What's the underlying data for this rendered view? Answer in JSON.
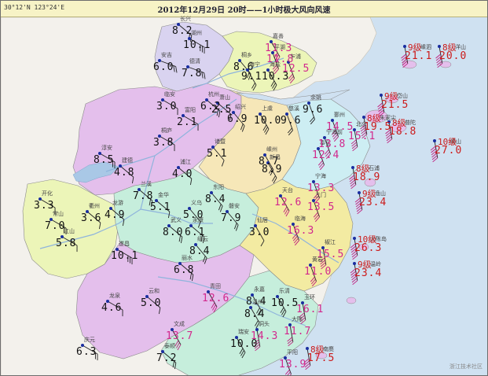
{
  "header": {
    "coords": "30°12'N 123°24'E",
    "title": "2012年12月29日 20时——1小时极大风向风速"
  },
  "watermark": "浙江技术社区",
  "colors": {
    "sea": "#cfe1f1",
    "land": "#f3f1ec",
    "river": "#a9c8e6",
    "station": "#1a2ea0",
    "normal_text": "#111111",
    "high_text": "#d2288d",
    "grade_text": "#cc1b1b"
  },
  "regions": [
    {
      "name": "huzhou",
      "fill": "#d9d3f0"
    },
    {
      "name": "jiaxing",
      "fill": "#ecf5b8"
    },
    {
      "name": "hangzhou",
      "fill": "#e4bfec"
    },
    {
      "name": "shaoxing",
      "fill": "#f6e7b8"
    },
    {
      "name": "ningbo",
      "fill": "#cdeef3"
    },
    {
      "name": "jinhua",
      "fill": "#c6eedc"
    },
    {
      "name": "quzhou",
      "fill": "#ecf5b8"
    },
    {
      "name": "taizhou",
      "fill": "#f3eba2"
    },
    {
      "name": "lishui",
      "fill": "#e4bfec"
    },
    {
      "name": "wenzhou",
      "fill": "#c6eedc"
    },
    {
      "name": "zhoushan",
      "fill": "#e4bfec"
    }
  ],
  "stations": [
    {
      "label": "长兴",
      "value": "8.2",
      "level": "normal"
    },
    {
      "label": "湖州",
      "value": "10.1",
      "level": "normal"
    },
    {
      "label": "嘉善",
      "value": "11.3",
      "level": "high"
    },
    {
      "label": "平湖",
      "value": "11.8",
      "level": "high"
    },
    {
      "label": "安吉",
      "value": "6.0",
      "level": "normal"
    },
    {
      "label": "德清",
      "value": "7.8",
      "level": "normal"
    },
    {
      "label": "桐乡",
      "value": "8.6",
      "level": "normal"
    },
    {
      "label": "海宁",
      "value": "9.1",
      "level": "normal"
    },
    {
      "label": "海盐",
      "value": "10.3",
      "level": "normal"
    },
    {
      "label": "乍浦",
      "value": "12.5",
      "level": "high"
    },
    {
      "label": "临安",
      "value": "3.0",
      "level": "normal"
    },
    {
      "label": "杭州",
      "value": "6.2",
      "level": "normal"
    },
    {
      "label": "萧山",
      "value": "2.5",
      "level": "normal"
    },
    {
      "label": "富阳",
      "value": "2.1",
      "level": "normal"
    },
    {
      "label": "绍兴",
      "value": "6.9",
      "level": "normal"
    },
    {
      "label": "上虞",
      "value": "10.0",
      "level": "normal"
    },
    {
      "label": "余姚",
      "value": "9.6",
      "level": "normal"
    },
    {
      "label": "慈溪",
      "value": "9.6",
      "level": "normal"
    },
    {
      "label": "桐庐",
      "value": "3.8",
      "level": "normal"
    },
    {
      "label": "诸暨",
      "value": "5.1",
      "level": "normal"
    },
    {
      "label": "淳安",
      "value": "8.5",
      "level": "normal"
    },
    {
      "label": "建德",
      "value": "4.8",
      "level": "normal"
    },
    {
      "label": "浦江",
      "value": "4.0",
      "level": "normal"
    },
    {
      "label": "嵊州",
      "value": "8.7",
      "level": "normal"
    },
    {
      "label": "新昌",
      "value": "8.9",
      "level": "normal"
    },
    {
      "label": "鄞州",
      "value": "14.5",
      "level": "high"
    },
    {
      "label": "北仑",
      "value": "15.1",
      "level": "high"
    },
    {
      "label": "奉化",
      "value": "12.4",
      "level": "high"
    },
    {
      "label": "宁海前",
      "value": "13.8",
      "level": "high"
    },
    {
      "label": "开化",
      "value": "3.3",
      "level": "normal"
    },
    {
      "label": "常山",
      "value": "7.0",
      "level": "normal"
    },
    {
      "label": "衢州",
      "value": "3.6",
      "level": "normal"
    },
    {
      "label": "龙游",
      "value": "4.9",
      "level": "normal"
    },
    {
      "label": "江山",
      "value": "5.8",
      "level": "normal"
    },
    {
      "label": "兰溪",
      "value": "7.8",
      "level": "normal"
    },
    {
      "label": "金华",
      "value": "5.1",
      "level": "normal"
    },
    {
      "label": "义乌",
      "value": "5.0",
      "level": "normal"
    },
    {
      "label": "东阳",
      "value": "8.4",
      "level": "normal"
    },
    {
      "label": "磐安",
      "value": "7.9",
      "level": "normal"
    },
    {
      "label": "天台",
      "value": "12.6",
      "level": "high"
    },
    {
      "label": "宁海",
      "value": "13.3",
      "level": "high"
    },
    {
      "label": "三门",
      "value": "13.5",
      "level": "high"
    },
    {
      "label": "武义",
      "value": "8.0",
      "level": "normal"
    },
    {
      "label": "永康",
      "value": "6.1",
      "level": "normal"
    },
    {
      "label": "仙居",
      "value": "3.0",
      "level": "normal"
    },
    {
      "label": "临海",
      "value": "16.3",
      "level": "high"
    },
    {
      "label": "遂昌",
      "value": "10.1",
      "level": "normal"
    },
    {
      "label": "缙云",
      "value": "8.4",
      "level": "normal"
    },
    {
      "label": "丽水",
      "value": "6.8",
      "level": "normal"
    },
    {
      "label": "椒江",
      "value": "15.5",
      "level": "high"
    },
    {
      "label": "黄岩",
      "value": "11.0",
      "level": "high"
    },
    {
      "label": "龙泉",
      "value": "4.6",
      "level": "normal"
    },
    {
      "label": "云和",
      "value": "5.0",
      "level": "normal"
    },
    {
      "label": "青田",
      "value": "12.6",
      "level": "high"
    },
    {
      "label": "永嘉",
      "value": "8.4",
      "level": "normal"
    },
    {
      "label": "温州",
      "value": "8.4",
      "level": "normal"
    },
    {
      "label": "乐清",
      "value": "10.5",
      "level": "normal"
    },
    {
      "label": "玉环",
      "value": "16.1",
      "level": "high"
    },
    {
      "label": "庆元",
      "value": "6.3",
      "level": "normal"
    },
    {
      "label": "文成",
      "value": "13.7",
      "level": "high"
    },
    {
      "label": "瑞安",
      "value": "10.0",
      "level": "normal"
    },
    {
      "label": "洞头",
      "value": "14.3",
      "level": "high"
    },
    {
      "label": "大陈",
      "value": "11.7",
      "level": "high"
    },
    {
      "label": "泰顺",
      "value": "7.2",
      "level": "normal"
    },
    {
      "label": "平阳",
      "value": "13.9",
      "level": "high"
    }
  ],
  "gale_stations": [
    {
      "label": "嵊泗",
      "grade": "9级",
      "value": "21.1"
    },
    {
      "label": "洋山",
      "grade": "8级",
      "value": "20.0"
    },
    {
      "label": "岱山",
      "grade": "9级",
      "value": "21.5"
    },
    {
      "label": "朱家尖",
      "grade": "8级",
      "value": "19.5"
    },
    {
      "label": "普陀",
      "grade": "8级",
      "value": "18.8"
    },
    {
      "label": "嵊山",
      "grade": "10级",
      "value": "27.0"
    },
    {
      "label": "石浦",
      "grade": "8级",
      "value": "18.9"
    },
    {
      "label": "渔山",
      "grade": "9级",
      "value": "23.4"
    },
    {
      "label": "大陈岛",
      "grade": "10级",
      "value": "26.3"
    },
    {
      "label": "温岭",
      "grade": "9级",
      "value": "23.4"
    },
    {
      "label": "南麂",
      "grade": "8级",
      "value": "17.5"
    }
  ]
}
